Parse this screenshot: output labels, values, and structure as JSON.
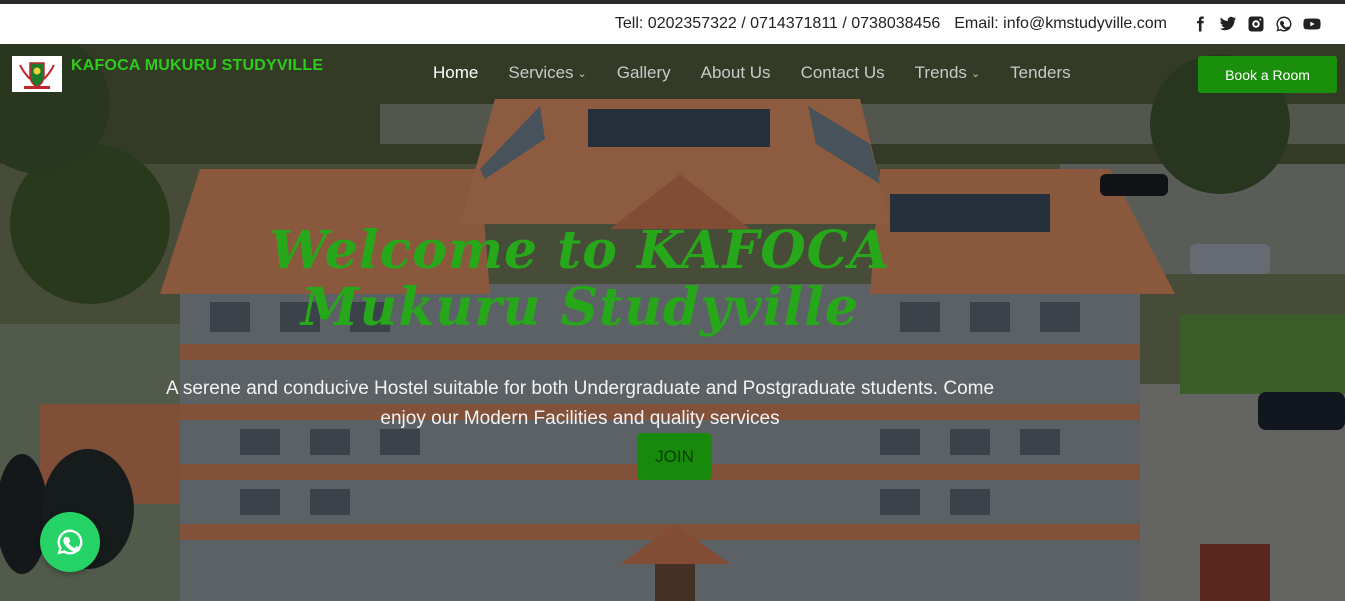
{
  "contact": {
    "phone_text": "Tell: 0202357322 / 0714371811 / 0738038456",
    "email_text": "Email: info@kmstudyville.com"
  },
  "social_icons": [
    "facebook-icon",
    "twitter-icon",
    "instagram-icon",
    "whatsapp-icon",
    "youtube-icon"
  ],
  "brand": {
    "name": "KAFOCA MUKURU STUDYVILLE",
    "color": "#2ecc1a"
  },
  "nav": {
    "items": [
      {
        "label": "Home",
        "active": true,
        "dropdown": false
      },
      {
        "label": "Services",
        "active": false,
        "dropdown": true
      },
      {
        "label": "Gallery",
        "active": false,
        "dropdown": false
      },
      {
        "label": "About Us",
        "active": false,
        "dropdown": false
      },
      {
        "label": "Contact Us",
        "active": false,
        "dropdown": false
      },
      {
        "label": "Trends",
        "active": false,
        "dropdown": true
      },
      {
        "label": "Tenders",
        "active": false,
        "dropdown": false
      }
    ],
    "book_label": "Book a Room"
  },
  "hero": {
    "title_line1": "Welcome to KAFOCA",
    "title_line2": "Mukuru Studyville",
    "subtitle_line1": "A serene and conducive Hostel suitable for both Undergraduate and Postgraduate students. Come",
    "subtitle_line2": "enjoy our Modern Facilities and quality services",
    "join_label": "JOIN"
  },
  "colors": {
    "accent_green": "#1a8f0c",
    "title_green": "#27a81a",
    "whatsapp_green": "#25d366"
  }
}
